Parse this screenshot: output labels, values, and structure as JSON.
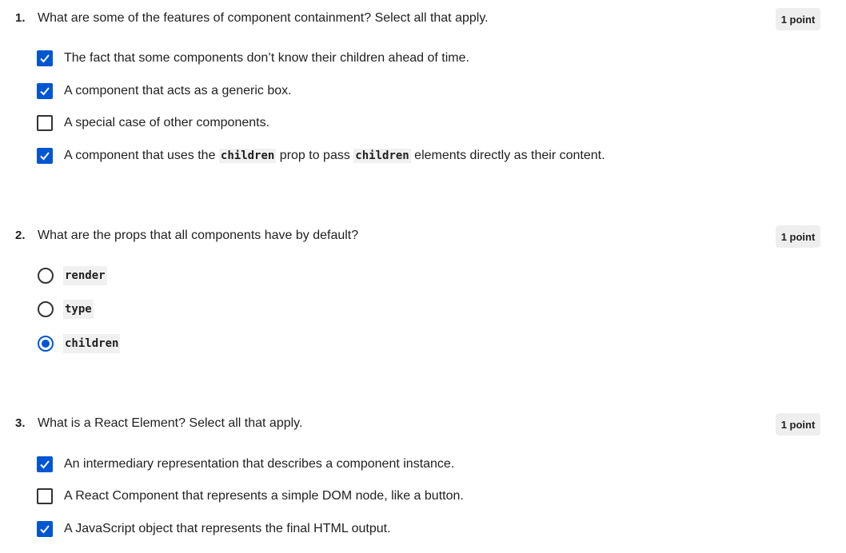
{
  "accent_color": "#0056d2",
  "questions": [
    {
      "number": "1.",
      "text": "What are some of the features of component containment? Select all that apply.",
      "points": "1 point",
      "input_type": "checkbox",
      "options": [
        {
          "label": "The fact that some components don’t know their children ahead of time.",
          "checked": true
        },
        {
          "label": "A component that acts as a generic box.",
          "checked": true
        },
        {
          "label": "A special case of other components.",
          "checked": false
        },
        {
          "label_parts": [
            "A component that uses the ",
            "children",
            " prop to pass ",
            "children",
            " elements directly as their content."
          ],
          "checked": true
        }
      ]
    },
    {
      "number": "2.",
      "text": "What are the props that all components have by default?",
      "points": "1 point",
      "input_type": "radio",
      "options": [
        {
          "label": "render",
          "checked": false
        },
        {
          "label": "type",
          "checked": false
        },
        {
          "label": "children",
          "checked": true
        }
      ]
    },
    {
      "number": "3.",
      "text": "What is a React Element? Select all that apply.",
      "points": "1 point",
      "input_type": "checkbox",
      "options": [
        {
          "label": "An intermediary representation that describes a component instance.",
          "checked": true
        },
        {
          "label": "A React Component that represents a simple DOM node, like a button.",
          "checked": false
        },
        {
          "label": "A JavaScript object that represents the final HTML output.",
          "checked": true
        }
      ]
    }
  ]
}
